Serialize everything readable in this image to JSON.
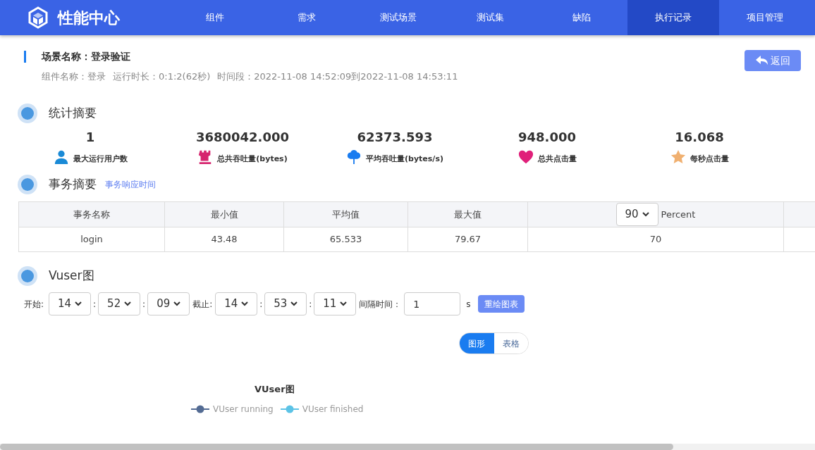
{
  "header": {
    "logo_text": "性能中心",
    "nav": [
      {
        "label": "组件",
        "selected": false
      },
      {
        "label": "需求",
        "selected": false
      },
      {
        "label": "测试场景",
        "selected": false
      },
      {
        "label": "测试集",
        "selected": false
      },
      {
        "label": "缺陷",
        "selected": false
      },
      {
        "label": "执行记录",
        "selected": true
      },
      {
        "label": "项目管理",
        "selected": false
      }
    ]
  },
  "scenario": {
    "title": "场景名称：登录验证",
    "meta": [
      "组件名称：登录",
      "运行时长：0:1:2(62秒)",
      "时间段：2022-11-08 14:52:09到2022-11-08 14:53:11"
    ],
    "back_button": "返回"
  },
  "stats": {
    "heading": "统计摘要",
    "items": [
      {
        "value": "1",
        "label": "最大运行用户数",
        "kind": "user",
        "color": "#1a8ad6"
      },
      {
        "value": "3680042.000",
        "label": "总共吞吐量(bytes)",
        "kind": "rook",
        "color": "#d6246e"
      },
      {
        "value": "62373.593",
        "label": "平均吞吐量(bytes/s)",
        "kind": "tree",
        "color": "#1a7cf0"
      },
      {
        "value": "948.000",
        "label": "总共点击量",
        "kind": "heart",
        "color": "#e0207a"
      },
      {
        "value": "16.068",
        "label": "每秒点击量",
        "kind": "star",
        "color": "#f0b070"
      }
    ]
  },
  "transactions": {
    "heading": "事务摘要",
    "link": "事务响应时间",
    "columns": [
      "事务名称",
      "最小值",
      "平均值",
      "最大值"
    ],
    "percent_select": "90",
    "percent_label": "Percent",
    "rows": [
      [
        "login",
        "43.48",
        "65.533",
        "79.67",
        "70"
      ]
    ]
  },
  "vuser": {
    "heading": "Vuser图",
    "start_label": "开始:",
    "start": [
      "14",
      "52",
      "09"
    ],
    "end_label": "截止:",
    "end": [
      "14",
      "53",
      "11"
    ],
    "separator": ":",
    "interval_label": "间隔时间：",
    "interval": "1",
    "unit": "s",
    "redraw_button": "重绘图表",
    "view_toggle": [
      {
        "label": "图形",
        "selected": true
      },
      {
        "label": "表格",
        "selected": false
      }
    ],
    "chart_title": "VUser图",
    "legend": [
      {
        "name": "VUser running",
        "color": "#536b93"
      },
      {
        "name": "VUser finished",
        "color": "#5cc3e6"
      }
    ]
  }
}
